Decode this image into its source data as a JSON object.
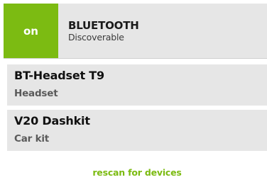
{
  "bluetooth": {
    "toggle_label": "on",
    "title": "BLUETOOTH",
    "subtitle": "Discoverable",
    "accent_color": "#7cbb12"
  },
  "devices": [
    {
      "name": "BT-Headset T9",
      "type": "Headset"
    },
    {
      "name": "V20 Dashkit",
      "type": "Car kit"
    }
  ],
  "actions": {
    "rescan_label": "rescan for devices"
  }
}
